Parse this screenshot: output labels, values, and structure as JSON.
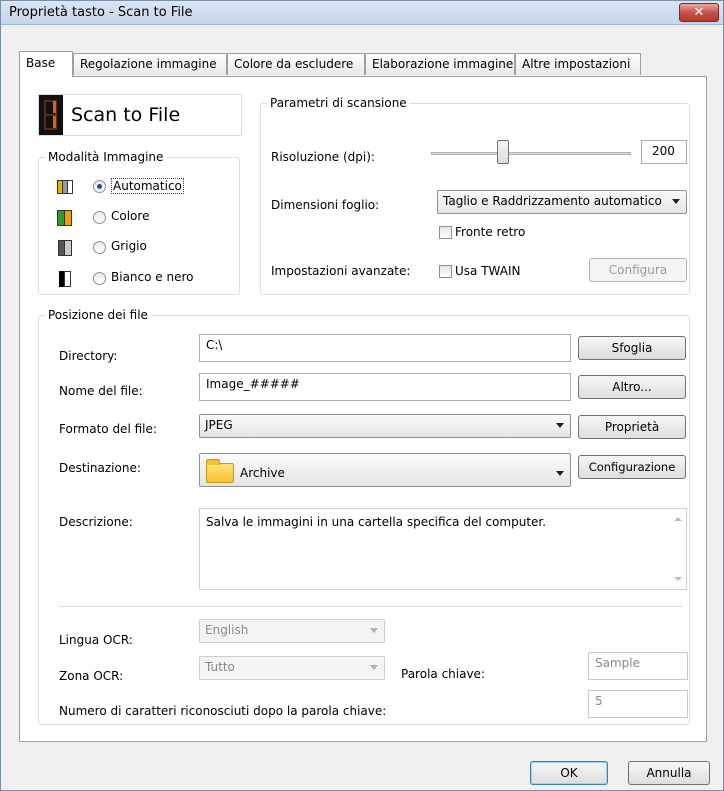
{
  "window": {
    "title": "Proprietà tasto - Scan to File",
    "close_glyph": "✕"
  },
  "tabs": [
    {
      "label": "Base",
      "active": true
    },
    {
      "label": "Regolazione immagine"
    },
    {
      "label": "Colore da escludere"
    },
    {
      "label": "Elaborazione immagine"
    },
    {
      "label": "Altre impostazioni"
    }
  ],
  "header": {
    "name": "Scan to File"
  },
  "image_mode": {
    "title": "Modalità Immagine",
    "options": [
      "Automatico",
      "Colore",
      "Grigio",
      "Bianco e nero"
    ],
    "selected": "Automatico"
  },
  "scan_params": {
    "title": "Parametri di scansione",
    "resolution_label": "Risoluzione (dpi):",
    "resolution_value": "200",
    "resolution_slider_level": 0.35,
    "paper_size_label": "Dimensioni foglio:",
    "paper_size_value": "Taglio e Raddrizzamento automatico",
    "duplex_label": "Fronte retro",
    "advanced_label": "Impostazioni avanzate:",
    "twain_label": "Usa TWAIN",
    "configure_button": "Configura"
  },
  "file_location": {
    "title": "Posizione dei file",
    "directory_label": "Directory:",
    "directory_value": "C:\\",
    "browse_button": "Sfoglia",
    "filename_label": "Nome del file:",
    "filename_value": "Image_#####",
    "more_button": "Altro...",
    "format_label": "Formato del file:",
    "format_value": "JPEG",
    "properties_button": "Proprietà",
    "destination_label": "Destinazione:",
    "destination_value": "Archive",
    "config_button": "Configurazione",
    "description_label": "Descrizione:",
    "description_value": "Salva le immagini in una cartella specifica del computer.",
    "ocr_language_label": "Lingua OCR:",
    "ocr_language_value": "English",
    "ocr_zone_label": "Zona OCR:",
    "ocr_zone_value": "Tutto",
    "keyword_label": "Parola chiave:",
    "keyword_value": "Sample",
    "chars_label": "Numero di caratteri riconosciuti dopo la parola chiave:",
    "chars_value": "5"
  },
  "footer": {
    "ok_button": "OK",
    "cancel_button": "Annulla"
  }
}
